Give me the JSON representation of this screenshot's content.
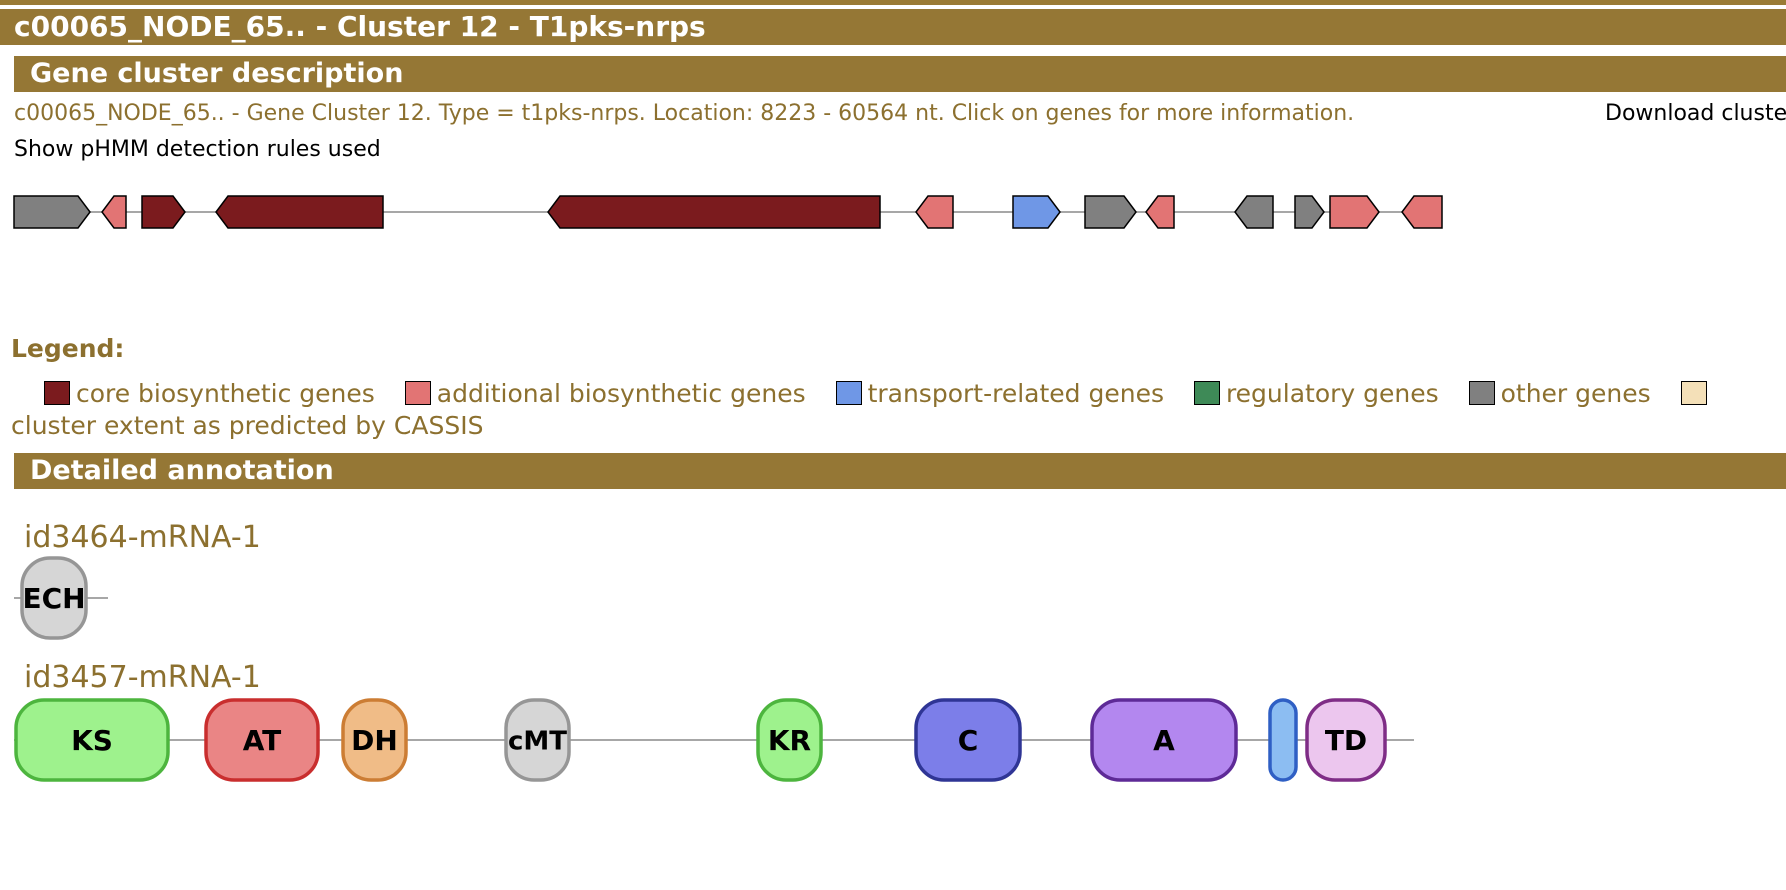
{
  "page_title": "c00065_NODE_65.. - Cluster 12 - T1pks-nrps",
  "sections": {
    "description": "Gene cluster description",
    "detailed": "Detailed annotation"
  },
  "description_text": "c00065_NODE_65.. - Gene Cluster 12. Type = t1pks-nrps. Location: 8223 - 60564 nt. Click on genes for more information.",
  "download_label": "Download cluste",
  "rules_link": "Show pHMM detection rules used",
  "colors": {
    "core": "#7b1b1e",
    "additional": "#e27474",
    "transport": "#6f97e6",
    "regulatory": "#3e8a57",
    "other": "#808080",
    "cassis": "#f4e0b8"
  },
  "legend": {
    "title": "Legend:",
    "items": [
      {
        "label": "core biosynthetic genes",
        "color": "#7b1b1e"
      },
      {
        "label": "additional biosynthetic genes",
        "color": "#e27474"
      },
      {
        "label": "transport-related genes",
        "color": "#6f97e6"
      },
      {
        "label": "regulatory genes",
        "color": "#3e8a57"
      },
      {
        "label": "other genes",
        "color": "#808080"
      },
      {
        "label": "cluster extent as predicted by CASSIS",
        "color": "#f4e0b8"
      }
    ]
  },
  "cluster_genes": [
    {
      "type": "other",
      "strand": "+"
    },
    {
      "type": "additional",
      "strand": "-"
    },
    {
      "type": "core",
      "strand": "+"
    },
    {
      "type": "core",
      "strand": "-"
    },
    {
      "type": "core",
      "strand": "-"
    },
    {
      "type": "additional",
      "strand": "-"
    },
    {
      "type": "transport",
      "strand": "+"
    },
    {
      "type": "other",
      "strand": "+"
    },
    {
      "type": "additional",
      "strand": "-"
    },
    {
      "type": "other",
      "strand": "-"
    },
    {
      "type": "other",
      "strand": "+"
    },
    {
      "type": "additional",
      "strand": "+"
    },
    {
      "type": "additional",
      "strand": "-"
    }
  ],
  "genes_detail": [
    {
      "name": "id3464-mRNA-1",
      "domains": [
        {
          "label": "ECH",
          "fill": "#d6d6d6",
          "stroke": "#969696"
        }
      ]
    },
    {
      "name": "id3457-mRNA-1",
      "domains": [
        {
          "label": "KS",
          "fill": "#9ef28d",
          "stroke": "#4db53e"
        },
        {
          "label": "AT",
          "fill": "#ea8585",
          "stroke": "#c92e2e"
        },
        {
          "label": "DH",
          "fill": "#f0bc87",
          "stroke": "#cc7d34"
        },
        {
          "label": "cMT",
          "fill": "#d6d6d6",
          "stroke": "#969696"
        },
        {
          "label": "KR",
          "fill": "#9ef28d",
          "stroke": "#4db53e"
        },
        {
          "label": "C",
          "fill": "#7c7ee9",
          "stroke": "#2f3595"
        },
        {
          "label": "A",
          "fill": "#b387ef",
          "stroke": "#5e2a97"
        },
        {
          "label": "",
          "fill": "#8cbdf2",
          "stroke": "#2f5fc4"
        },
        {
          "label": "TD",
          "fill": "#ecc6ee",
          "stroke": "#7f2d86"
        }
      ]
    }
  ]
}
